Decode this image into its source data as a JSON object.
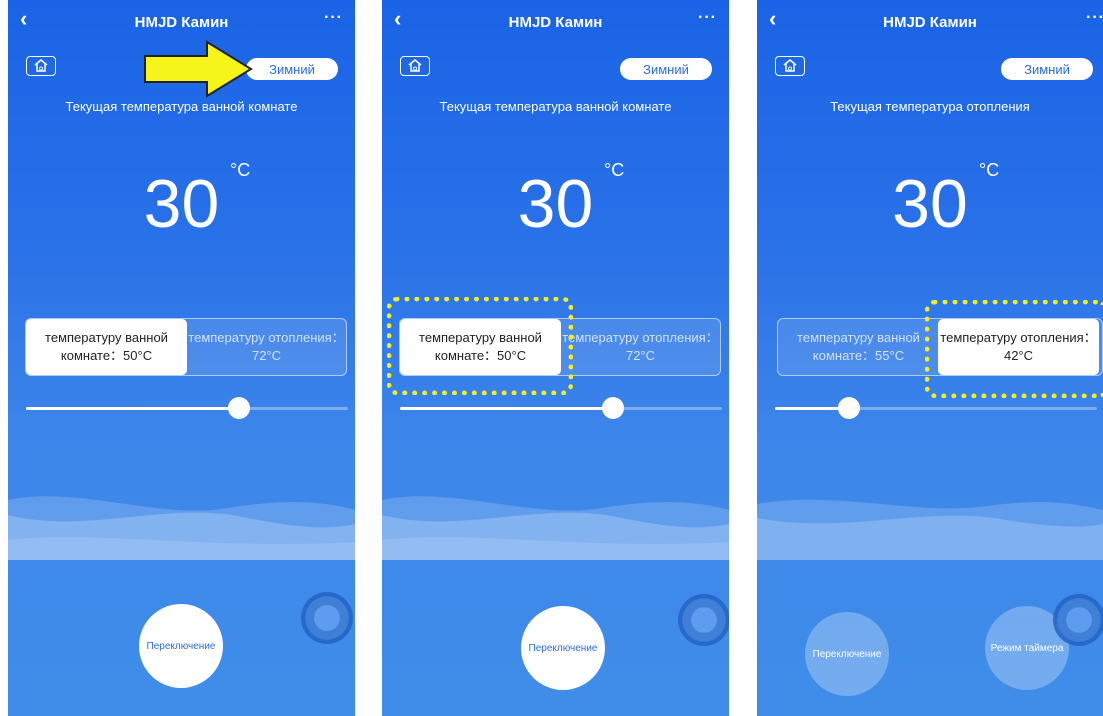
{
  "app": {
    "title": "HMJD Камин",
    "back_icon": "‹",
    "more_icon": "···",
    "home_icon": "home-icon",
    "season_label": "Зимний"
  },
  "panels": [
    {
      "subtitle": "Текущая температура ванной комнате",
      "temperature": "30",
      "unit": "°C",
      "options": [
        {
          "label": "температуру ванной комнате：50°C",
          "active": true
        },
        {
          "label": "температуру отопления：72°C",
          "active": false
        }
      ],
      "slider_level": 0.66,
      "buttons": [
        "Переключение"
      ]
    },
    {
      "subtitle": "Текущая температура ванной комнате",
      "temperature": "30",
      "unit": "°C",
      "options": [
        {
          "label": "температуру ванной комнате：50°C",
          "active": true
        },
        {
          "label": "температуру отопления：72°C",
          "active": false
        }
      ],
      "slider_level": 0.66,
      "buttons": [
        "Переключение"
      ]
    },
    {
      "subtitle": "Текущая температура отопления",
      "temperature": "30",
      "unit": "°C",
      "options": [
        {
          "label": "температуру ванной комнате：55°C",
          "active": false
        },
        {
          "label": "температуру отопления：42°C",
          "active": true
        }
      ],
      "slider_level": 0.23,
      "buttons": [
        "Переключение",
        "Режим таймера"
      ]
    }
  ],
  "annotations": {
    "arrow_color": "#f5f51a",
    "highlight_color": "#f4ef1a"
  },
  "colors": {
    "accent": "#2a6fe0",
    "background_top": "#1a63e6",
    "background_bottom": "#3f8de9"
  }
}
